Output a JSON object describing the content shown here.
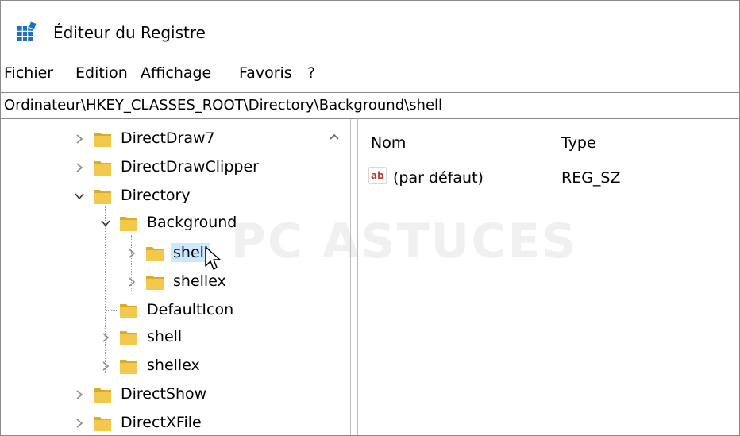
{
  "window": {
    "title": "Éditeur du Registre"
  },
  "menu": [
    "Fichier",
    "Edition",
    "Affichage",
    "Favoris",
    "?"
  ],
  "address": {
    "path": "Ordinateur\\HKEY_CLASSES_ROOT\\Directory\\Background\\shell"
  },
  "tree": {
    "nodes": [
      {
        "label": "DirectDraw7",
        "expander": "collapsed"
      },
      {
        "label": "DirectDrawClipper",
        "expander": "collapsed"
      },
      {
        "label": "Directory",
        "expander": "expanded"
      },
      {
        "label": "Background",
        "expander": "expanded"
      },
      {
        "label": "shell",
        "expander": "collapsed",
        "selected": true
      },
      {
        "label": "shellex",
        "expander": "collapsed"
      },
      {
        "label": "DefaultIcon",
        "expander": "none"
      },
      {
        "label": "shell",
        "expander": "collapsed"
      },
      {
        "label": "shellex",
        "expander": "collapsed"
      },
      {
        "label": "DirectShow",
        "expander": "collapsed"
      },
      {
        "label": "DirectXFile",
        "expander": "collapsed"
      }
    ]
  },
  "list": {
    "columns": {
      "name": "Nom",
      "type": "Type"
    },
    "rows": [
      {
        "name": "(par défaut)",
        "type": "REG_SZ",
        "icon": "string-value-icon"
      }
    ]
  },
  "watermark": "PC ASTUCES",
  "colors": {
    "folder": "#f2c94c",
    "folder_dark": "#dcaa2a",
    "selection": "#cce8ff",
    "ab_icon": "#c0392b",
    "app_icon": "#1e73be"
  }
}
